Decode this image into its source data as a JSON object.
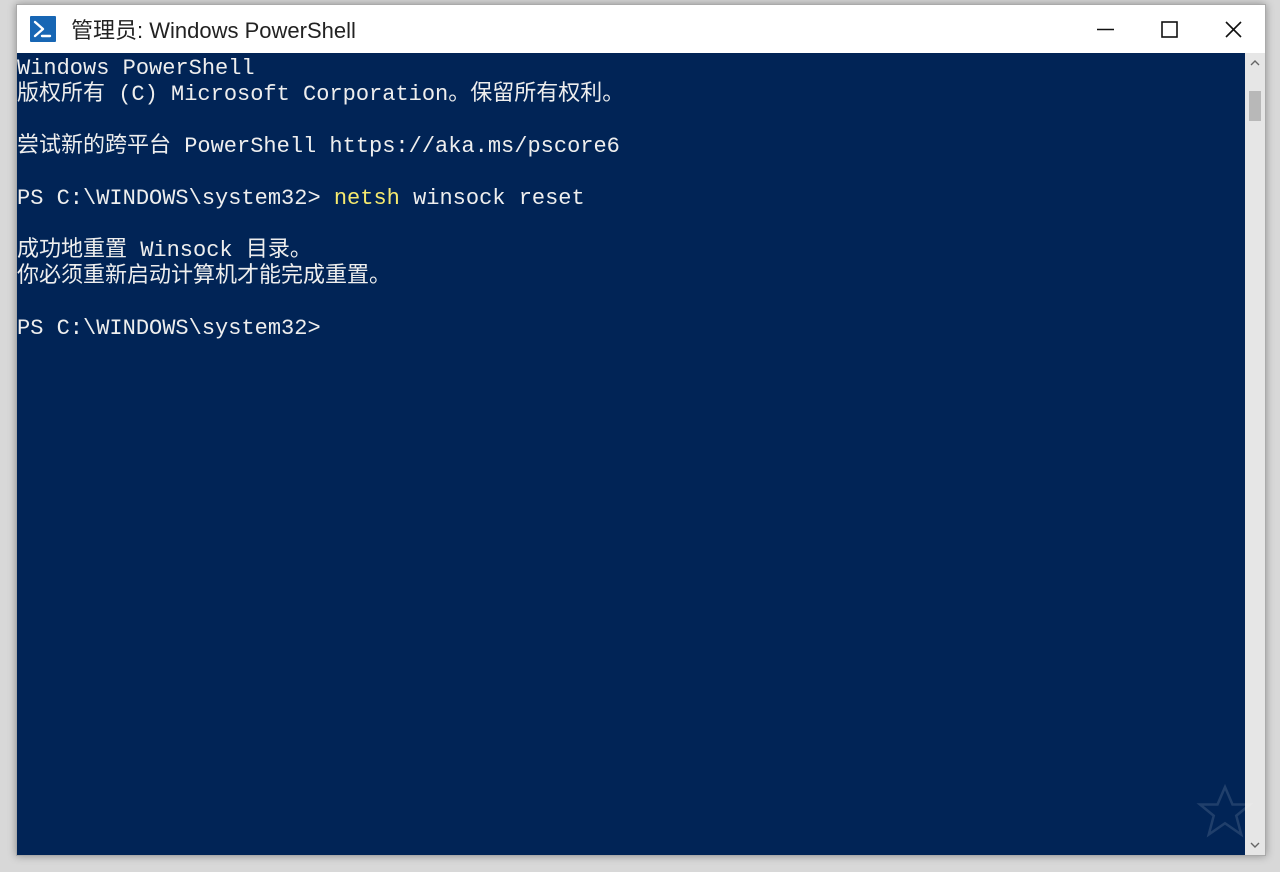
{
  "window": {
    "title": "管理员: Windows PowerShell"
  },
  "console": {
    "banner_title": "Windows PowerShell",
    "banner_copyright": "版权所有 (C) Microsoft Corporation。保留所有权利。",
    "banner_try": "尝试新的跨平台 PowerShell https://aka.ms/pscore6",
    "prompt1": "PS C:\\WINDOWS\\system32> ",
    "command_highlight": "netsh",
    "command_rest": " winsock reset",
    "result_line1": "成功地重置 Winsock 目录。",
    "result_line2": "你必须重新启动计算机才能完成重置。",
    "prompt2": "PS C:\\WINDOWS\\system32>"
  },
  "colors": {
    "console_bg": "#012456",
    "command_color": "#f5e96e"
  }
}
